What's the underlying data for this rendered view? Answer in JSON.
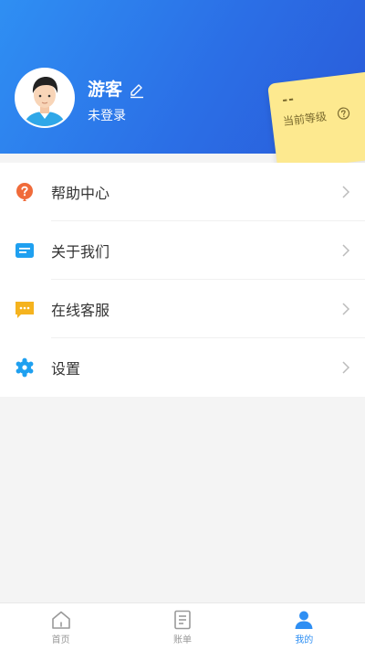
{
  "profile": {
    "name": "游客",
    "status": "未登录"
  },
  "level": {
    "value": "--",
    "label": "当前等级"
  },
  "menu": {
    "items": [
      {
        "label": "帮助中心",
        "icon": "help-icon",
        "color": "#f06b3a"
      },
      {
        "label": "关于我们",
        "icon": "info-card-icon",
        "color": "#1fa0f0"
      },
      {
        "label": "在线客服",
        "icon": "chat-icon",
        "color": "#f5b31e"
      },
      {
        "label": "设置",
        "icon": "settings-icon",
        "color": "#1fa0f0"
      }
    ]
  },
  "tabs": [
    {
      "label": "首页",
      "icon": "home-icon",
      "active": false
    },
    {
      "label": "账单",
      "icon": "bill-icon",
      "active": false
    },
    {
      "label": "我的",
      "icon": "user-icon",
      "active": true
    }
  ],
  "colors": {
    "header_start": "#2f8ff3",
    "header_end": "#2a5bd9",
    "level_card": "#fde98f",
    "accent": "#2f8ff3"
  }
}
